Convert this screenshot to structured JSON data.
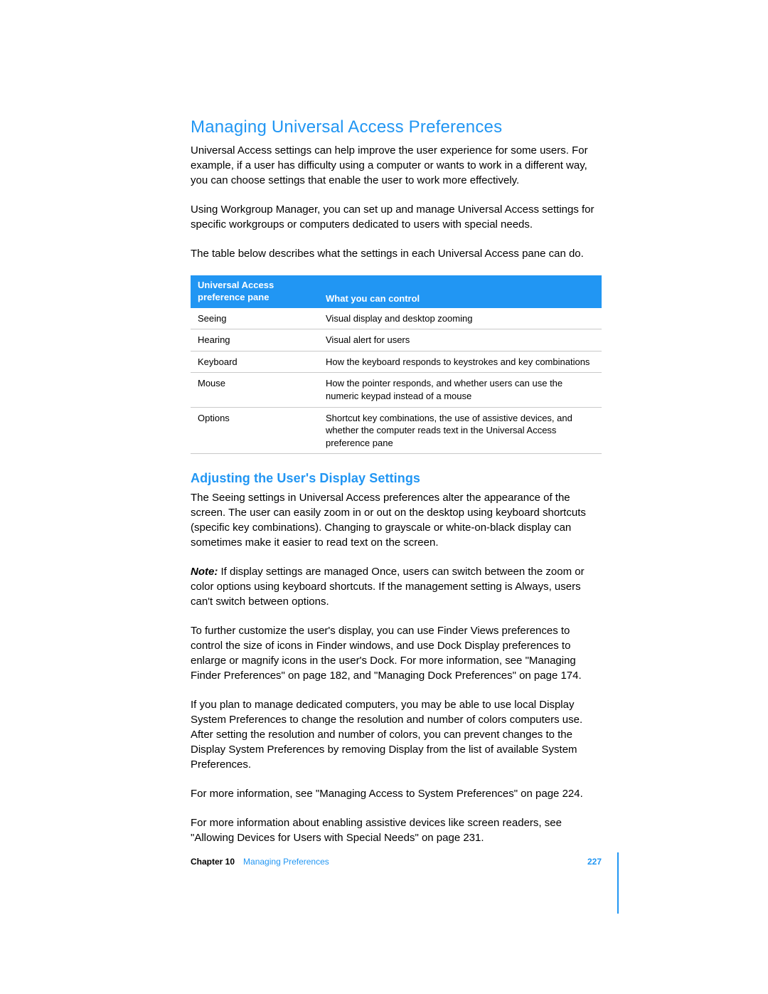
{
  "h1": "Managing Universal Access Preferences",
  "intro1": "Universal Access settings can help improve the user experience for some users. For example, if a user has difficulty using a computer or wants to work in a different way, you can choose settings that enable the user to work more effectively.",
  "intro2": "Using Workgroup Manager, you can set up and manage Universal Access settings for specific workgroups or computers dedicated to users with special needs.",
  "intro3": "The table below describes what the settings in each Universal Access pane can do.",
  "table": {
    "headers": {
      "col1a": "Universal Access",
      "col1b": "preference pane",
      "col2": "What you can control"
    },
    "rows": [
      {
        "pane": "Seeing",
        "desc": "Visual display and desktop zooming"
      },
      {
        "pane": "Hearing",
        "desc": "Visual alert for users"
      },
      {
        "pane": "Keyboard",
        "desc": "How the keyboard responds to keystrokes and key combinations"
      },
      {
        "pane": "Mouse",
        "desc": "How the pointer responds, and whether users can use the numeric keypad instead of a mouse"
      },
      {
        "pane": "Options",
        "desc": "Shortcut key combinations, the use of assistive devices, and whether the computer reads text in the Universal Access preference pane"
      }
    ]
  },
  "h2": "Adjusting the User's Display Settings",
  "sec1": "The Seeing settings in Universal Access preferences alter the appearance of the screen. The user can easily zoom in or out on the desktop using keyboard shortcuts (specific key combinations). Changing to grayscale or white-on-black display can sometimes make it easier to read text on the screen.",
  "noteLabel": "Note:",
  "sec2": "  If display settings are managed Once, users can switch between the zoom or color options using keyboard shortcuts. If the management setting is Always, users can't switch between options.",
  "sec3": "To further customize the user's display, you can use Finder Views preferences to control the size of icons in Finder windows, and use Dock Display preferences to enlarge or magnify icons in the user's Dock. For more information, see \"Managing Finder Preferences\" on page 182, and \"Managing Dock Preferences\" on page 174.",
  "sec4": "If you plan to manage dedicated computers, you may be able to use local Display System Preferences to change the resolution and number of colors computers use. After setting the resolution and number of colors, you can prevent changes to the Display System Preferences by removing Display from the list of available System Preferences.",
  "sec5": "For more information, see \"Managing Access to System Preferences\" on page 224.",
  "sec6": "For more information about enabling assistive devices like screen readers, see \"Allowing Devices for Users with Special Needs\" on page 231.",
  "footer": {
    "chapter": "Chapter 10",
    "title": "Managing Preferences",
    "page": "227"
  }
}
